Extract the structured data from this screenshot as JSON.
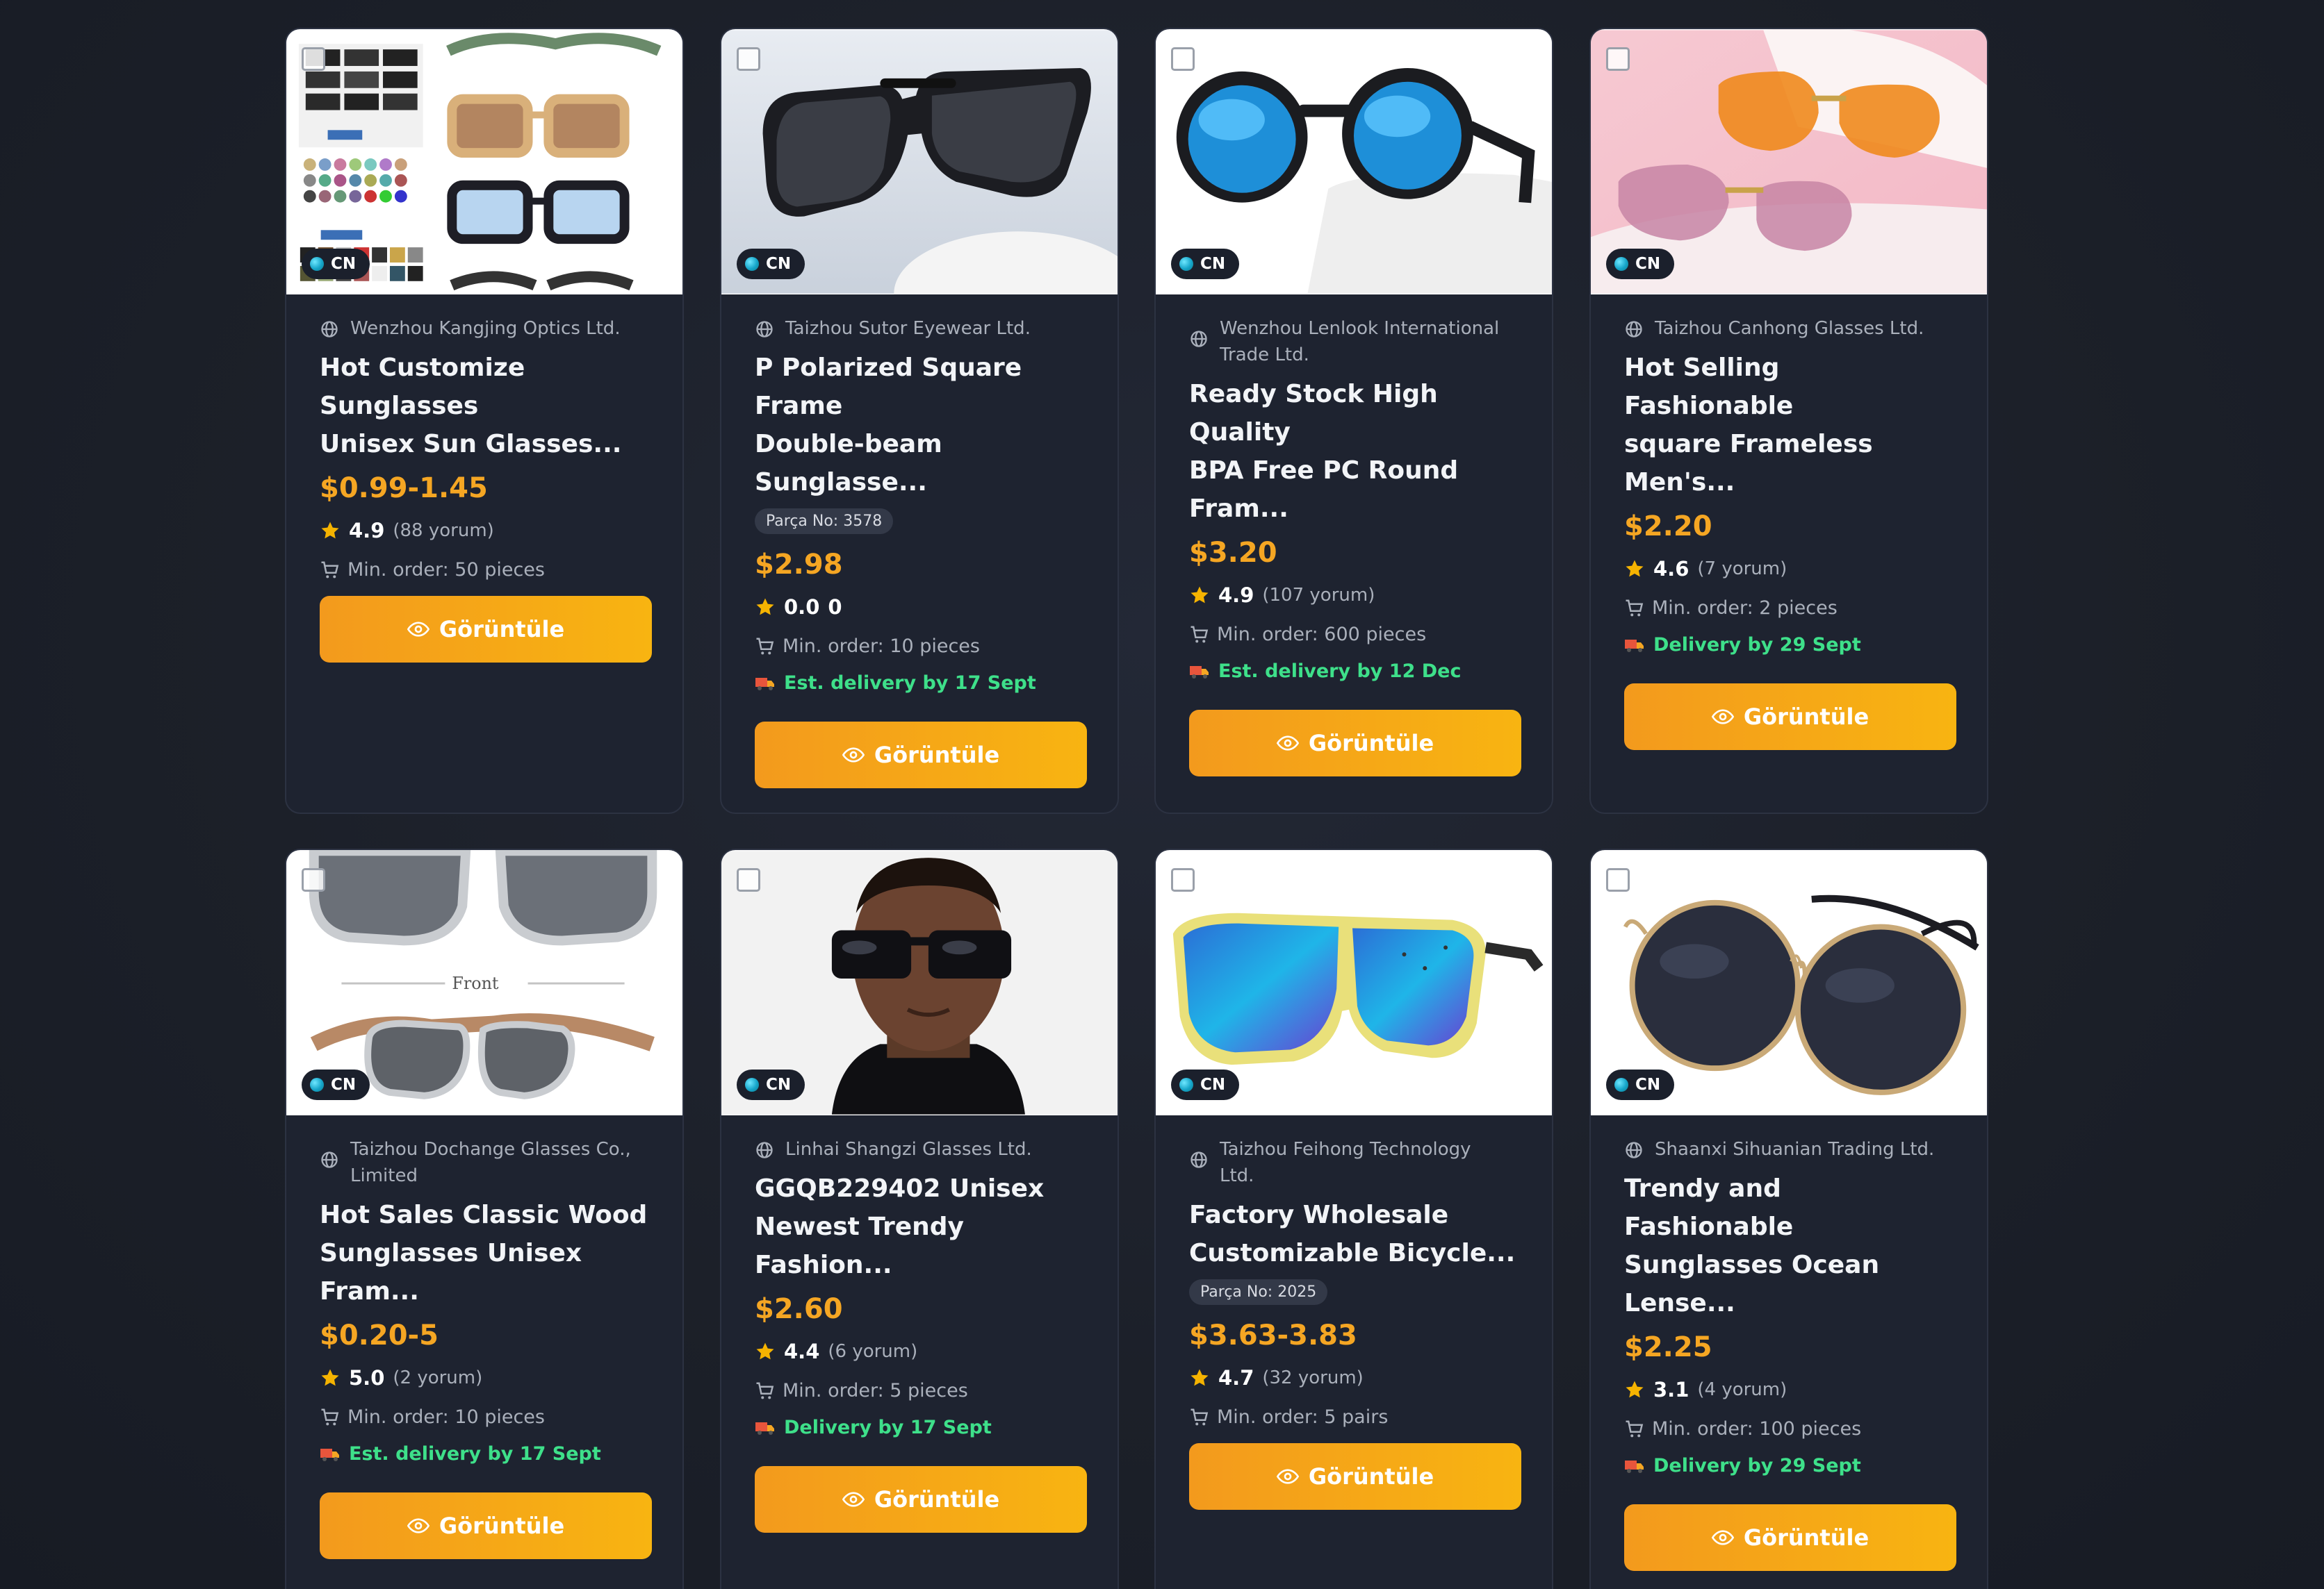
{
  "badges": {
    "country": "CN"
  },
  "labels": {
    "view_button": "Görüntüle"
  },
  "colors": {
    "background": "#1a1f2b",
    "card": "#1e2330",
    "price": "#f5a623",
    "delivery": "#3ee08a",
    "button": "#f5a623"
  },
  "products": [
    {
      "supplier": "Wenzhou Kangjing Optics Ltd.",
      "title_line1": "Hot Customize Sunglasses",
      "title_line2": "Unisex Sun Glasses...",
      "price": "$0.99-1.45",
      "rating": "4.9",
      "reviews": "(88 yorum)",
      "min_order": "Min. order: 50 pieces"
    },
    {
      "supplier": "Taizhou Sutor Eyewear Ltd.",
      "title_line1": "P Polarized Square Frame",
      "title_line2": "Double-beam Sunglasse...",
      "part_no": "Parça No: 3578",
      "price": "$2.98",
      "rating": "0.0",
      "reviews": "0",
      "min_order": "Min. order: 10 pieces",
      "delivery": "Est. delivery by 17 Sept"
    },
    {
      "supplier_line1": "Wenzhou Lenlook International",
      "supplier_line2": "Trade Ltd.",
      "title_line1": "Ready Stock High Quality",
      "title_line2": "BPA Free PC Round Fram...",
      "price": "$3.20",
      "rating": "4.9",
      "reviews": "(107 yorum)",
      "min_order": "Min. order: 600 pieces",
      "delivery": "Est. delivery by 12 Dec"
    },
    {
      "supplier": "Taizhou Canhong Glasses Ltd.",
      "title_line1": "Hot Selling Fashionable",
      "title_line2": "square Frameless Men's...",
      "price": "$2.20",
      "rating": "4.6",
      "reviews": "(7 yorum)",
      "min_order": "Min. order: 2 pieces",
      "delivery": "Delivery by 29 Sept"
    },
    {
      "supplier_line1": "Taizhou Dochange Glasses Co.,",
      "supplier_line2": "Limited",
      "title_line1": "Hot Sales Classic Wood",
      "title_line2": "Sunglasses Unisex Fram...",
      "price": "$0.20-5",
      "rating": "5.0",
      "reviews": "(2 yorum)",
      "min_order": "Min. order: 10 pieces",
      "delivery": "Est. delivery by 17 Sept",
      "image_text": "Front"
    },
    {
      "supplier": "Linhai Shangzi Glasses Ltd.",
      "title_line1": "GGQB229402 Unisex",
      "title_line2": "Newest Trendy Fashion...",
      "price": "$2.60",
      "rating": "4.4",
      "reviews": "(6 yorum)",
      "min_order": "Min. order: 5 pieces",
      "delivery": "Delivery by 17 Sept"
    },
    {
      "supplier_line1": "Taizhou Feihong Technology",
      "supplier_line2": "Ltd.",
      "title_line1": "Factory Wholesale",
      "title_line2": "Customizable Bicycle...",
      "part_no": "Parça No: 2025",
      "price": "$3.63-3.83",
      "rating": "4.7",
      "reviews": "(32 yorum)",
      "min_order": "Min. order: 5 pairs"
    },
    {
      "supplier": "Shaanxi Sihuanian Trading Ltd.",
      "title_line1": "Trendy and Fashionable",
      "title_line2": "Sunglasses Ocean Lense...",
      "price": "$2.25",
      "rating": "3.1",
      "reviews": "(4 yorum)",
      "min_order": "Min. order: 100 pieces",
      "delivery": "Delivery by 29 Sept"
    }
  ]
}
